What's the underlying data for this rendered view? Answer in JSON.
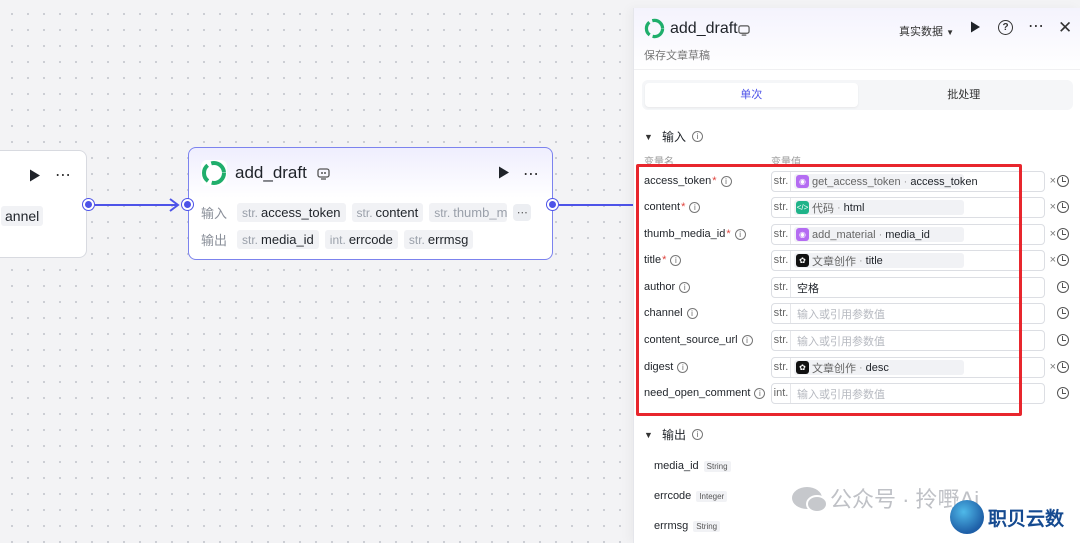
{
  "canvas": {
    "prev_node": {
      "cut_text": "annel"
    },
    "main_node": {
      "title": "add_draft",
      "inputs_label": "输入",
      "inputs": [
        {
          "type": "str.",
          "name": "access_token"
        },
        {
          "type": "str.",
          "name": "content"
        },
        {
          "type": "str.",
          "name": "thumb_m"
        }
      ],
      "outputs_label": "输出",
      "outputs": [
        {
          "type": "str.",
          "name": "media_id"
        },
        {
          "type": "int.",
          "name": "errcode"
        },
        {
          "type": "str.",
          "name": "errmsg"
        }
      ]
    }
  },
  "panel": {
    "title": "add_draft",
    "description": "保存文章草稿",
    "mode": "真实数据",
    "tabs": [
      {
        "label": "单次",
        "active": true
      },
      {
        "label": "批处理",
        "active": false
      }
    ],
    "input_section": "输入",
    "col_name": "变量名",
    "col_value": "变量值",
    "fields": [
      {
        "name": "access_token",
        "required": true,
        "type": "str.",
        "ref": {
          "badge": "plugin",
          "source": "get_access_token",
          "field": "access_token"
        }
      },
      {
        "name": "content",
        "required": true,
        "type": "str.",
        "ref": {
          "badge": "code",
          "source": "代码",
          "field": "html"
        }
      },
      {
        "name": "thumb_media_id",
        "required": true,
        "type": "str.",
        "ref": {
          "badge": "plugin",
          "source": "add_material",
          "field": "media_id"
        }
      },
      {
        "name": "title",
        "required": true,
        "type": "str.",
        "ref": {
          "badge": "llm",
          "source": "文章创作",
          "field": "title"
        }
      },
      {
        "name": "author",
        "required": false,
        "type": "str.",
        "value": "空格"
      },
      {
        "name": "channel",
        "required": false,
        "type": "str.",
        "placeholder": "输入或引用参数值"
      },
      {
        "name": "content_source_url",
        "required": false,
        "type": "str.",
        "placeholder": "输入或引用参数值"
      },
      {
        "name": "digest",
        "required": false,
        "type": "str.",
        "ref": {
          "badge": "llm",
          "source": "文章创作",
          "field": "desc"
        }
      },
      {
        "name": "need_open_comment",
        "required": false,
        "type": "int.",
        "placeholder": "输入或引用参数值"
      }
    ],
    "output_section": "输出",
    "outputs": [
      {
        "name": "media_id",
        "type": "String"
      },
      {
        "name": "errcode",
        "type": "Integer"
      },
      {
        "name": "errmsg",
        "type": "String"
      }
    ]
  },
  "watermark": {
    "text": "公众号 · 拎嘢Ai",
    "brand": "职贝云数"
  },
  "colors": {
    "accent": "#4d53e8",
    "highlight": "#e8262d"
  }
}
